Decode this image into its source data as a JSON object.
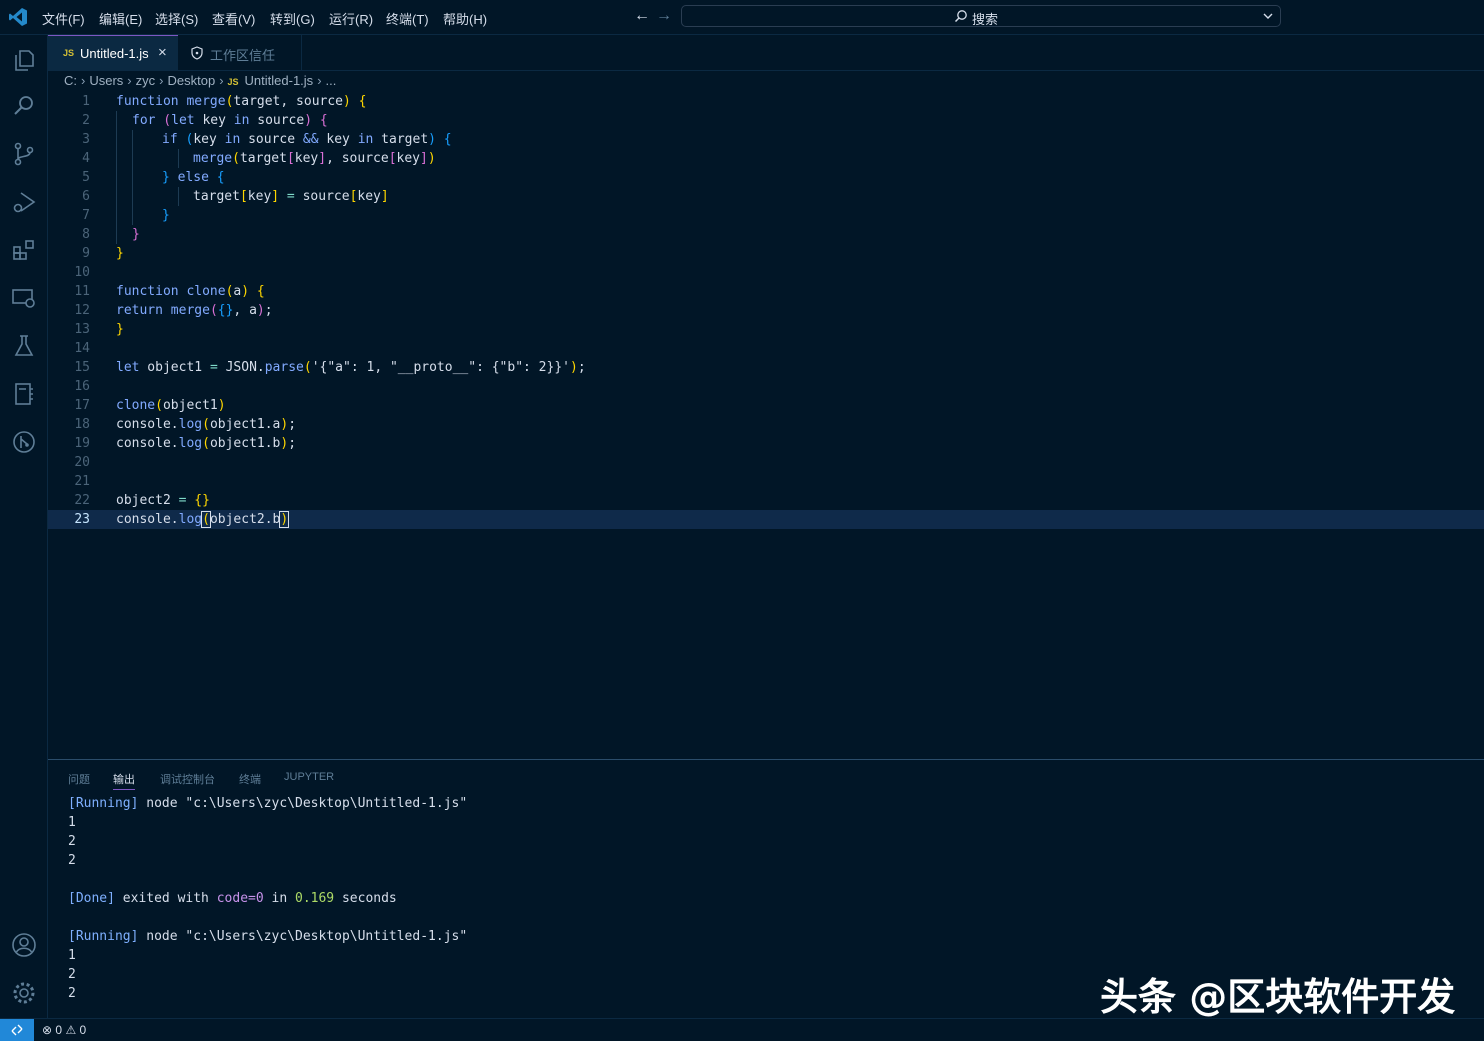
{
  "menu": [
    "文件(F)",
    "编辑(E)",
    "选择(S)",
    "查看(V)",
    "转到(G)",
    "运行(R)",
    "终端(T)",
    "帮助(H)"
  ],
  "command_center": {
    "label": "搜索"
  },
  "tabs": [
    {
      "badge": "JS",
      "label": "Untitled-1.js",
      "close": "×"
    },
    {
      "label": "工作区信任"
    }
  ],
  "breadcrumb": [
    "C:",
    "Users",
    "zyc",
    "Desktop",
    "Untitled-1.js",
    "..."
  ],
  "breadcrumb_badge": "JS",
  "editor": {
    "line_numbers": [
      "1",
      "2",
      "3",
      "4",
      "5",
      "6",
      "7",
      "8",
      "9",
      "10",
      "11",
      "12",
      "13",
      "14",
      "15",
      "16",
      "17",
      "18",
      "19",
      "20",
      "21",
      "22",
      "23"
    ],
    "code": {
      "l1": [
        "function",
        " merge",
        "(",
        "target, source",
        ")",
        " {"
      ],
      "l2": [
        "for",
        " (",
        "let",
        " key ",
        "in",
        " source",
        ")",
        " {"
      ],
      "l3": [
        "if",
        " (",
        "key ",
        "in",
        " source ",
        "&&",
        " key ",
        "in",
        " target",
        ")",
        " {"
      ],
      "l4": [
        "merge",
        "(",
        "target",
        "[",
        "key",
        "]",
        ", source",
        "[",
        "key",
        "]",
        ")"
      ],
      "l5": [
        "}",
        " else",
        " {"
      ],
      "l6": [
        "target",
        "[",
        "key",
        "]",
        " = ",
        "source",
        "[",
        "key",
        "]"
      ],
      "l7": [
        "}"
      ],
      "l8": [
        "}"
      ],
      "l9": [
        "}"
      ],
      "l11": [
        "function",
        " clone",
        "(",
        "a",
        ")",
        " {"
      ],
      "l12": [
        "return",
        " merge",
        "(",
        "{}",
        ", a",
        ")",
        ";"
      ],
      "l13": [
        "}"
      ],
      "l15": [
        "let",
        " object1 ",
        "=",
        " JSON.",
        "parse",
        "(",
        "'{\"a\": 1, \"__proto__\": {\"b\": 2}}'",
        ")",
        ";"
      ],
      "l17": [
        "clone",
        "(",
        "object1",
        ")"
      ],
      "l18": [
        "console.",
        "log",
        "(",
        "object1.a",
        ")",
        ";"
      ],
      "l19": [
        "console.",
        "log",
        "(",
        "object1.b",
        ")",
        ";"
      ],
      "l22": [
        "object2 ",
        "=",
        " ",
        "{}"
      ],
      "l23": [
        "console.",
        "log",
        "(",
        "object2.b",
        ")"
      ]
    }
  },
  "panel": {
    "tabs": [
      "问题",
      "输出",
      "调试控制台",
      "终端",
      "JUPYTER"
    ],
    "output": {
      "run1_tag": "[Running]",
      "run1_cmd": " node \"c:\\Users\\zyc\\Desktop\\Untitled-1.js\"",
      "values1": [
        "1",
        "2",
        "2"
      ],
      "done_tag": "[Done]",
      "done_text1": " exited with ",
      "done_code": "code=0",
      "done_text2": " in ",
      "done_secs": "0.169",
      "done_text3": " seconds",
      "run2_tag": "[Running]",
      "run2_cmd": " node \"c:\\Users\\zyc\\Desktop\\Untitled-1.js\"",
      "values2": [
        "1",
        "2",
        "2"
      ]
    }
  },
  "status": {
    "errors": "0",
    "warnings": "0"
  },
  "watermark": "头条 @区块软件开发",
  "icons": [
    "vscode-logo",
    "arrow-left",
    "arrow-right",
    "search",
    "chevron-down",
    "explorer",
    "search",
    "source-control",
    "run-debug",
    "extensions",
    "remote-explorer",
    "testing",
    "notebook",
    "git-graph",
    "account",
    "settings-gear",
    "shield",
    "remote-connection",
    "error",
    "warning"
  ]
}
